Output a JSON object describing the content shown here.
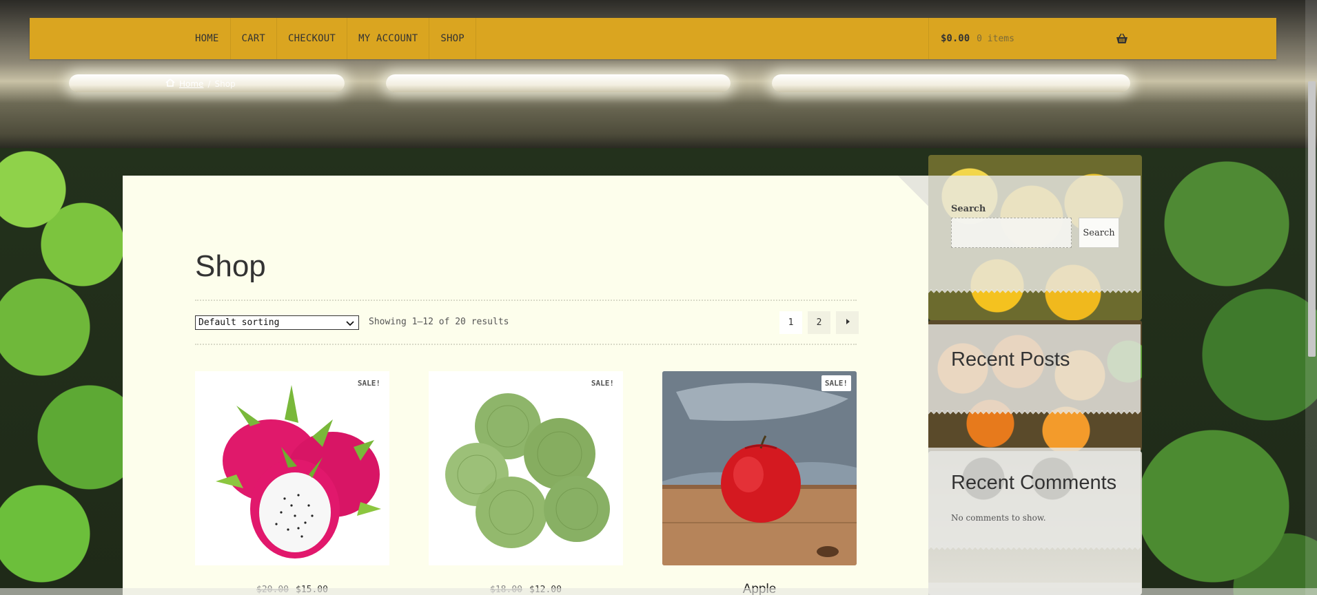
{
  "nav": {
    "items": [
      {
        "label": "HOME"
      },
      {
        "label": "CART"
      },
      {
        "label": "CHECKOUT"
      },
      {
        "label": "MY ACCOUNT"
      },
      {
        "label": "SHOP"
      }
    ],
    "cart_amount": "$0.00",
    "cart_count": "0 items",
    "cart_icon": "basket-icon"
  },
  "breadcrumb": {
    "home": "Home",
    "current": "Shop"
  },
  "page": {
    "title": "Shop"
  },
  "toolbar": {
    "sort_value": "Default sorting",
    "result_count": "Showing 1–12 of 20 results",
    "pages": [
      "1",
      "2"
    ],
    "next_icon": "caret-right-icon"
  },
  "products": [
    {
      "badge": "SALE!",
      "old_price": "$20.00",
      "price": "$15.00",
      "image": "dragon-fruit"
    },
    {
      "badge": "SALE!",
      "old_price": "$18.00",
      "price": "$12.00",
      "image": "custard-apple"
    },
    {
      "badge": "SALE!",
      "title": "Apple",
      "image": "red-apple"
    }
  ],
  "sidebar": {
    "search_label": "Search",
    "search_button": "Search",
    "recent_posts_title": "Recent Posts",
    "recent_comments_title": "Recent Comments",
    "no_comments": "No comments to show."
  },
  "colors": {
    "navbar": "#daa520",
    "content_bg": "#fdfeec"
  }
}
